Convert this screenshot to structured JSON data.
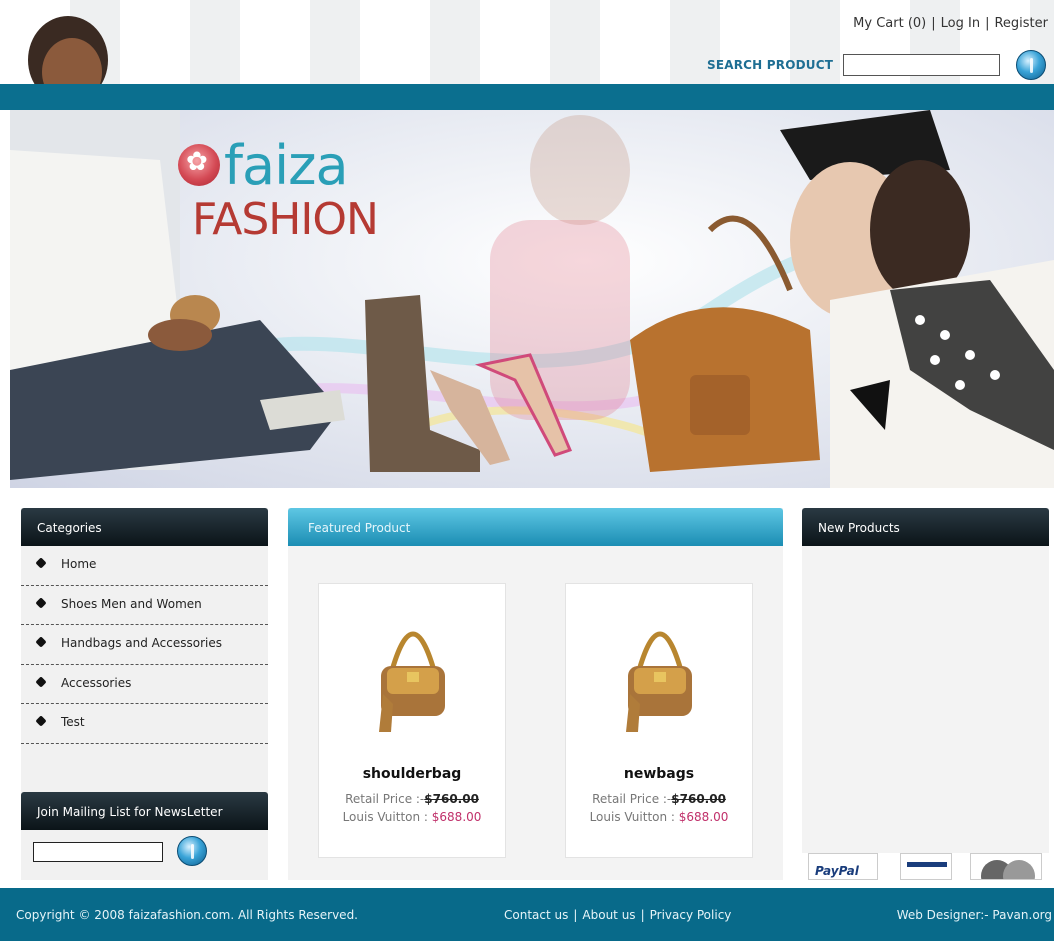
{
  "header": {
    "cart_label": "My Cart (0)",
    "login_label": "Log In",
    "register_label": "Register",
    "separator": "|",
    "search_label": "SEARCH PRODUCT",
    "search_value": "",
    "search_button_icon": "circle-arrow-icon"
  },
  "banner": {
    "logo_word1": "faiza",
    "logo_word2": "FASHION",
    "logo_icon": "flower-icon"
  },
  "sidebar": {
    "categories_title": "Categories",
    "categories": [
      {
        "label": "Home"
      },
      {
        "label": "Shoes Men and Women"
      },
      {
        "label": "Handbags and Accessories"
      },
      {
        "label": "Accessories"
      },
      {
        "label": "Test"
      }
    ],
    "mailing_title": "Join Mailing List for NewsLetter",
    "mailing_value": ""
  },
  "featured": {
    "title": "Featured Product",
    "products": [
      {
        "name": "shoulderbag",
        "retail_label": "Retail Price :-",
        "retail_price": "$760.00",
        "brand_label": "Louis Vuitton :",
        "sale_price": "$688.00"
      },
      {
        "name": "newbags",
        "retail_label": "Retail Price :-",
        "retail_price": "$760.00",
        "brand_label": "Louis Vuitton :",
        "sale_price": "$688.00"
      }
    ]
  },
  "new_products": {
    "title": "New Products",
    "payment_logos": [
      "PayPal",
      "Visa",
      "MasterCard"
    ]
  },
  "footer": {
    "copyright": "Copyright © 2008 faizafashion.com. All Rights Reserved.",
    "contact": "Contact us",
    "about": "About us",
    "privacy": "Privacy Policy",
    "designer": "Web Designer:- Pavan.org"
  },
  "colors": {
    "teal_bar": "#0b6f8f",
    "footer": "#086a8a",
    "search_label": "#1e6e93",
    "sale_price": "#c0306a",
    "logo_faiza": "#2a9fb7",
    "logo_fashion": "#b53a33"
  }
}
